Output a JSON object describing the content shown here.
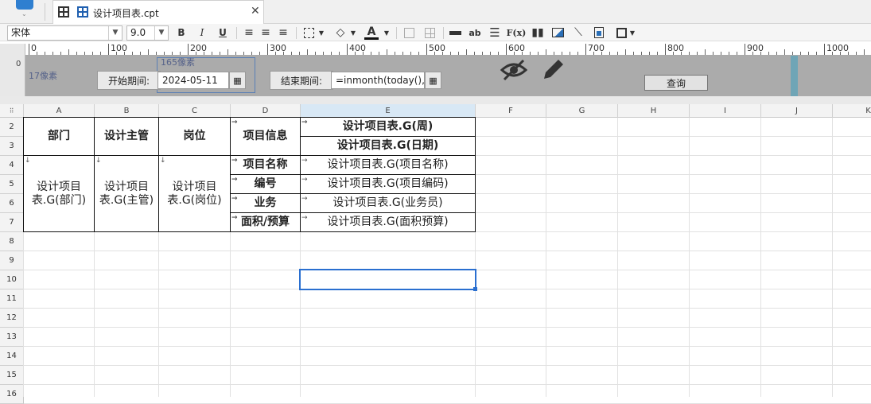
{
  "tab": {
    "title": "设计项目表.cpt"
  },
  "toolbar": {
    "font": "宋体",
    "size": "9.0",
    "bold": "B",
    "italic": "I",
    "underline": "U",
    "text_ab": "ab",
    "fx": "F(x)",
    "font_color": "A"
  },
  "ruler": {
    "marks": [
      "0",
      "100",
      "200",
      "300",
      "400",
      "500",
      "600",
      "700",
      "800",
      "900",
      "1000"
    ]
  },
  "vruler": {
    "zero": "0"
  },
  "param": {
    "width_label": "165像素",
    "height_label": "17像素",
    "start_label": "开始期间:",
    "start_value": "2024-05-11",
    "end_label": "结束期间:",
    "end_value": "=inmonth(today(),-1)",
    "query": "查询"
  },
  "columns": [
    "A",
    "B",
    "C",
    "D",
    "E",
    "F",
    "G",
    "H",
    "I",
    "J",
    "K"
  ],
  "rows": [
    "2",
    "3",
    "4",
    "5",
    "6",
    "7",
    "8",
    "9",
    "10",
    "11",
    "12",
    "13",
    "14",
    "15",
    "16"
  ],
  "cells": {
    "a2": "部门",
    "b2": "设计主管",
    "c2": "岗位",
    "d2": "项目信息",
    "e2": "设计项目表.G(周)",
    "e3": "设计项目表.G(日期)",
    "a4": "设计项目表.G(部门)",
    "b4": "设计项目表.G(主管)",
    "c4": "设计项目表.G(岗位)",
    "d4": "项目名称",
    "e4": "设计项目表.G(项目名称)",
    "d5": "编号",
    "e5": "设计项目表.G(项目编码)",
    "d6": "业务",
    "e6": "设计项目表.G(业务员)",
    "d7": "面积/预算",
    "e7": "设计项目表.G(面积预算)"
  },
  "selected_cell": "E10"
}
